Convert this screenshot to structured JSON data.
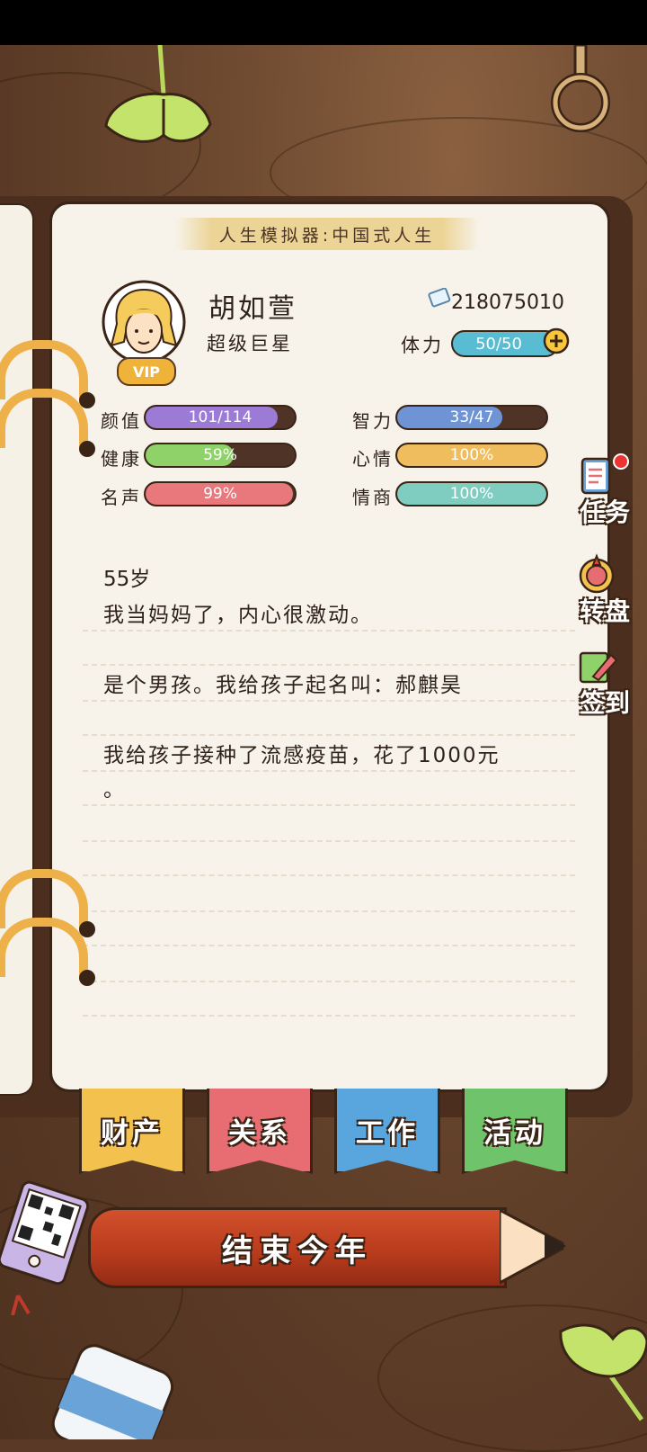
{
  "app": {
    "title": "人生模拟器:中国式人生"
  },
  "profile": {
    "name": "胡如萱",
    "occupation": "超级巨星",
    "vip_label": "VIP",
    "money": "218075010",
    "stamina_label": "体力",
    "stamina_value": "50/50",
    "stamina_fraction": 1.0
  },
  "stats": [
    {
      "label": "颜值",
      "text": "101/114",
      "fraction": 0.886,
      "color": "#9b7bd6"
    },
    {
      "label": "智力",
      "text": "33/47",
      "fraction": 0.702,
      "color": "#6e94d6"
    },
    {
      "label": "健康",
      "text": "59%",
      "fraction": 0.59,
      "color": "#8fd26a"
    },
    {
      "label": "心情",
      "text": "100%",
      "fraction": 1.0,
      "color": "#f0bd5e"
    },
    {
      "label": "名声",
      "text": "99%",
      "fraction": 0.99,
      "color": "#e8787c"
    },
    {
      "label": "情商",
      "text": "100%",
      "fraction": 1.0,
      "color": "#7fcdc1"
    }
  ],
  "log": {
    "age": "55岁",
    "entries": [
      "我当妈妈了，内心很激动。",
      "是个男孩。我给孩子起名叫：郝麒昊",
      "我给孩子接种了流感疫苗，花了1000元",
      "。"
    ]
  },
  "side_buttons": {
    "tasks": "任务",
    "wheel": "转盘",
    "checkin": "签到"
  },
  "tabs": {
    "assets": "财产",
    "relations": "关系",
    "work": "工作",
    "activities": "活动"
  },
  "end_year_label": "结束今年",
  "colors": {
    "tab_assets": "#f2c14e",
    "tab_relations": "#e86d72",
    "tab_work": "#58a6dd",
    "tab_activities": "#6fc36a",
    "stamina": "#58bcd2"
  }
}
